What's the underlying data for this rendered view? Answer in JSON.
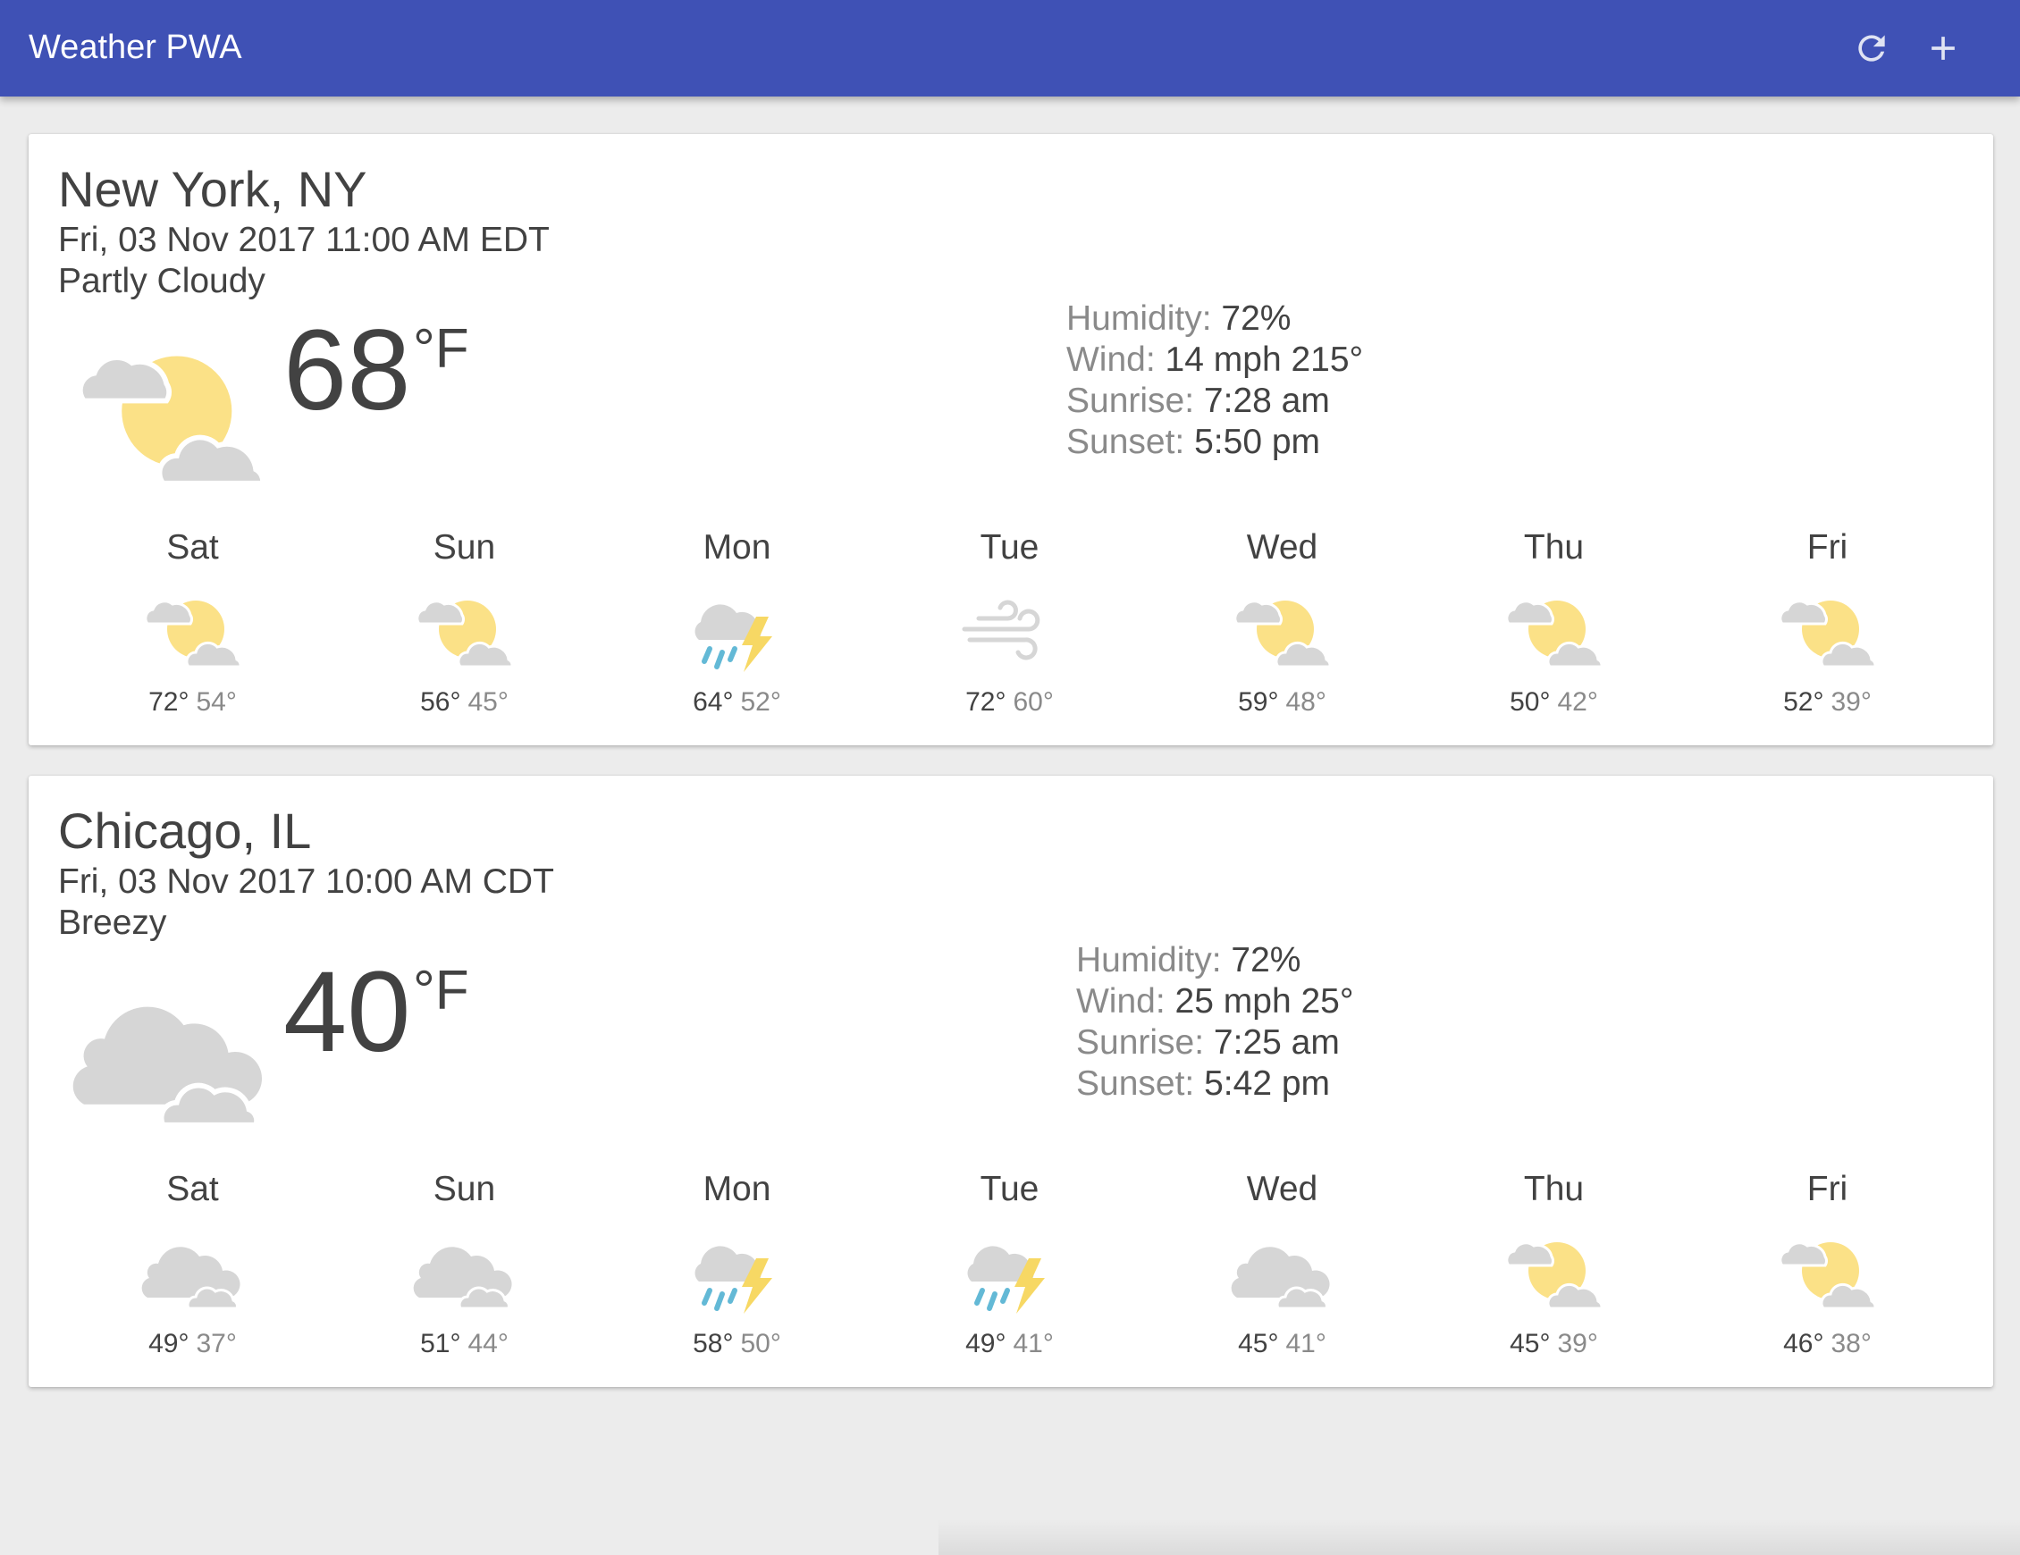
{
  "header": {
    "title": "Weather PWA",
    "refresh_icon": "refresh-icon",
    "add_icon": "plus-icon",
    "color": "#3f51b5"
  },
  "cards": [
    {
      "location": "New York, NY",
      "date": "Fri, 03 Nov 2017 11:00 AM EDT",
      "description": "Partly Cloudy",
      "icon": "partly-cloudy-icon",
      "temperature": "68",
      "scale": "°F",
      "details": {
        "humidity_label": "Humidity:",
        "humidity": "72%",
        "wind_label": "Wind:",
        "wind": "14 mph 215°",
        "sunrise_label": "Sunrise:",
        "sunrise": "7:28 am",
        "sunset_label": "Sunset:",
        "sunset": "5:50 pm"
      },
      "forecast": [
        {
          "day": "Sat",
          "icon": "partly-cloudy-icon",
          "high": "72°",
          "low": "54°"
        },
        {
          "day": "Sun",
          "icon": "partly-cloudy-icon",
          "high": "56°",
          "low": "45°"
        },
        {
          "day": "Mon",
          "icon": "thunderstorm-icon",
          "high": "64°",
          "low": "52°"
        },
        {
          "day": "Tue",
          "icon": "windy-icon",
          "high": "72°",
          "low": "60°"
        },
        {
          "day": "Wed",
          "icon": "partly-cloudy-icon",
          "high": "59°",
          "low": "48°"
        },
        {
          "day": "Thu",
          "icon": "partly-cloudy-icon",
          "high": "50°",
          "low": "42°"
        },
        {
          "day": "Fri",
          "icon": "partly-cloudy-icon",
          "high": "52°",
          "low": "39°"
        }
      ]
    },
    {
      "location": "Chicago, IL",
      "date": "Fri, 03 Nov 2017 10:00 AM CDT",
      "description": "Breezy",
      "icon": "cloudy-icon",
      "temperature": "40",
      "scale": "°F",
      "details": {
        "humidity_label": "Humidity:",
        "humidity": "72%",
        "wind_label": "Wind:",
        "wind": "25 mph 25°",
        "sunrise_label": "Sunrise:",
        "sunrise": "7:25 am",
        "sunset_label": "Sunset:",
        "sunset": "5:42 pm"
      },
      "forecast": [
        {
          "day": "Sat",
          "icon": "cloudy-icon",
          "high": "49°",
          "low": "37°"
        },
        {
          "day": "Sun",
          "icon": "cloudy-icon",
          "high": "51°",
          "low": "44°"
        },
        {
          "day": "Mon",
          "icon": "thunderstorm-icon",
          "high": "58°",
          "low": "50°"
        },
        {
          "day": "Tue",
          "icon": "thunderstorm-icon",
          "high": "49°",
          "low": "41°"
        },
        {
          "day": "Wed",
          "icon": "cloudy-icon",
          "high": "45°",
          "low": "41°"
        },
        {
          "day": "Thu",
          "icon": "partly-cloudy-icon",
          "high": "45°",
          "low": "39°"
        },
        {
          "day": "Fri",
          "icon": "partly-cloudy-icon",
          "high": "46°",
          "low": "38°"
        }
      ]
    }
  ],
  "colors": {
    "sun": "#fbe187",
    "cloud": "#d6d6d6",
    "rain": "#63b9d6",
    "bolt": "#f7d864",
    "label_gray": "#8a8a8a",
    "text_dark": "#424242"
  }
}
